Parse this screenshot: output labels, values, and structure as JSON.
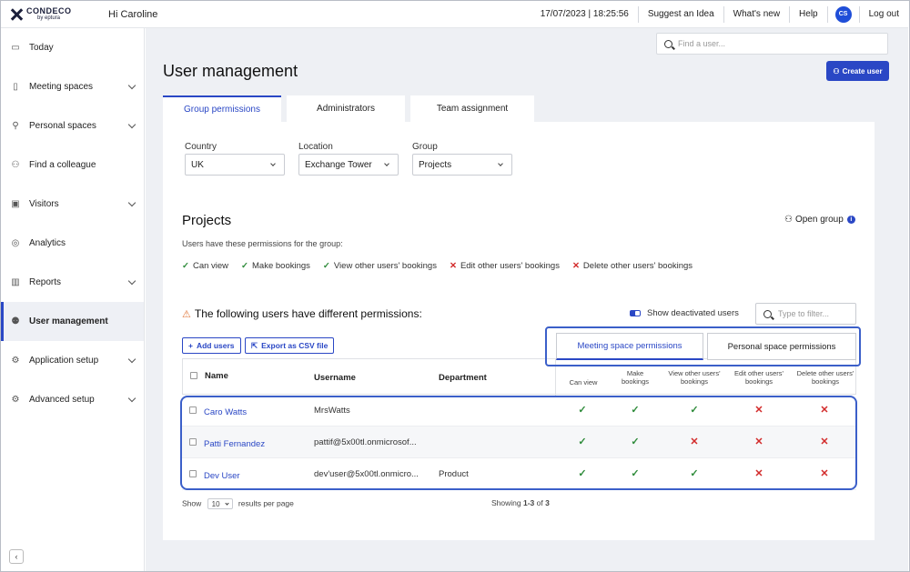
{
  "brand": {
    "name": "CONDECO",
    "sub": "by eptura"
  },
  "header": {
    "greeting": "Hi Caroline",
    "datetime": "17/07/2023 | 18:25:56",
    "links": [
      "Suggest an Idea",
      "What's new",
      "Help"
    ],
    "avatar": "CS",
    "logout": "Log out"
  },
  "sidebar": {
    "items": [
      {
        "label": "Today",
        "icon": "calendar-icon"
      },
      {
        "label": "Meeting spaces",
        "icon": "meeting-room-icon"
      },
      {
        "label": "Personal spaces",
        "icon": "desk-icon"
      },
      {
        "label": "Find a colleague",
        "icon": "people-search-icon"
      },
      {
        "label": "Visitors",
        "icon": "visitor-badge-icon"
      },
      {
        "label": "Analytics",
        "icon": "analytics-icon"
      },
      {
        "label": "Reports",
        "icon": "reports-icon"
      },
      {
        "label": "User management",
        "icon": "user-management-icon"
      },
      {
        "label": "Application setup",
        "icon": "gear-icon"
      },
      {
        "label": "Advanced setup",
        "icon": "advanced-gear-icon"
      }
    ],
    "collapse": "‹"
  },
  "search": {
    "placeholder": "Find a user..."
  },
  "page": {
    "title": "User management",
    "create_button": "Create user"
  },
  "tabs": [
    "Group permissions",
    "Administrators",
    "Team assignment"
  ],
  "filters": {
    "country_label": "Country",
    "country_value": "UK",
    "location_label": "Location",
    "location_value": "Exchange Tower",
    "group_label": "Group",
    "group_value": "Projects"
  },
  "group": {
    "title": "Projects",
    "open_group": "Open group",
    "description": "Users have these permissions for the group:",
    "permissions": [
      {
        "label": "Can view",
        "granted": true
      },
      {
        "label": "Make bookings",
        "granted": true
      },
      {
        "label": "View other users' bookings",
        "granted": true
      },
      {
        "label": "Edit other users' bookings",
        "granted": false
      },
      {
        "label": "Delete other users' bookings",
        "granted": false
      }
    ]
  },
  "diff": {
    "title": "The following users have different permissions:",
    "show_deactivated": "Show deactivated users",
    "filter_placeholder": "Type to filter...",
    "add_users": "Add users",
    "export_csv": "Export as CSV file",
    "seg_meeting": "Meeting space permissions",
    "seg_personal": "Personal space permissions"
  },
  "table": {
    "headers": {
      "name": "Name",
      "username": "Username",
      "department": "Department"
    },
    "perm_headers": [
      "Can view",
      "Make bookings",
      "View other users' bookings",
      "Edit other users' bookings",
      "Delete other users' bookings"
    ],
    "rows": [
      {
        "name": "Caro Watts",
        "username": "MrsWatts",
        "department": "",
        "perms": [
          true,
          true,
          true,
          false,
          false
        ]
      },
      {
        "name": "Patti Fernandez",
        "username": "pattif@5x00tl.onmicrosof...",
        "department": "",
        "perms": [
          true,
          true,
          false,
          false,
          false
        ]
      },
      {
        "name": "Dev User",
        "username": "dev'user@5x00tl.onmicro...",
        "department": "Product",
        "perms": [
          true,
          true,
          true,
          false,
          false
        ]
      }
    ]
  },
  "footer": {
    "show": "Show",
    "page_size": "10",
    "per_page": "results per page",
    "showing_prefix": "Showing ",
    "range": "1-3",
    "of": " of ",
    "total": "3"
  }
}
